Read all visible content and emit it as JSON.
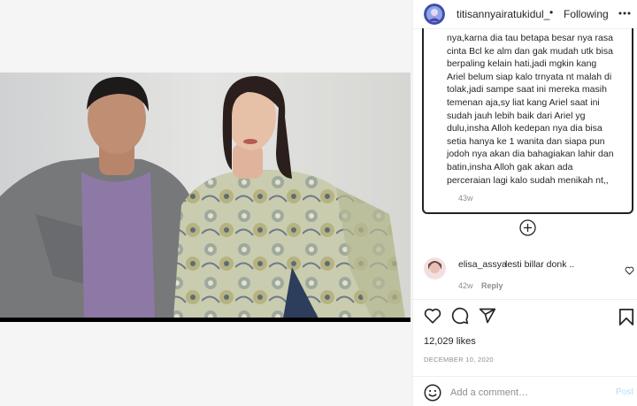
{
  "post": {
    "author_username": "titisannyairatukidul_",
    "follow_status": "Following",
    "separator": "•"
  },
  "comment": {
    "text": "nya,karna dia tau betapa besar nya rasa\ncinta Bcl ke alm dan gak mudah utk bisa\nberpaling kelain hati,jadi mgkin kang\nAriel belum siap kalo trnyata nt malah di\ntolak,jadi sampe saat ini mereka masih\ntemenan aja,sy liat kang Ariel saat ini\nsudah jauh lebih baik dari Ariel yg\ndulu,insha Alloh kedepan nya dia bisa\nsetia hanya ke 1 wanita dan siapa pun\njodoh nya akan dia bahagiakan lahir dan\nbatin,insha Alloh gak akan ada\nperceraian lagi kalo sudah menikah nt,,",
    "time": "43w"
  },
  "reply": {
    "username": "elisa_assya",
    "text": "lesti billar donk ..",
    "time": "42w",
    "reply_label": "Reply"
  },
  "stats": {
    "likes": "12,029 likes",
    "date": "DECEMBER 10, 2020"
  },
  "composer": {
    "placeholder": "Add a comment…",
    "post_label": "Post"
  },
  "icons": {
    "more": "more-horizontal-icon",
    "load_more": "plus-circle-icon",
    "like": "heart-icon",
    "comment": "comment-bubble-icon",
    "share": "paper-plane-icon",
    "save": "bookmark-icon",
    "emoji": "emoji-smile-icon"
  },
  "colors": {
    "post_button_disabled": "#b2dffc",
    "muted_text": "#8e8e8e",
    "primary_text": "#262626"
  }
}
